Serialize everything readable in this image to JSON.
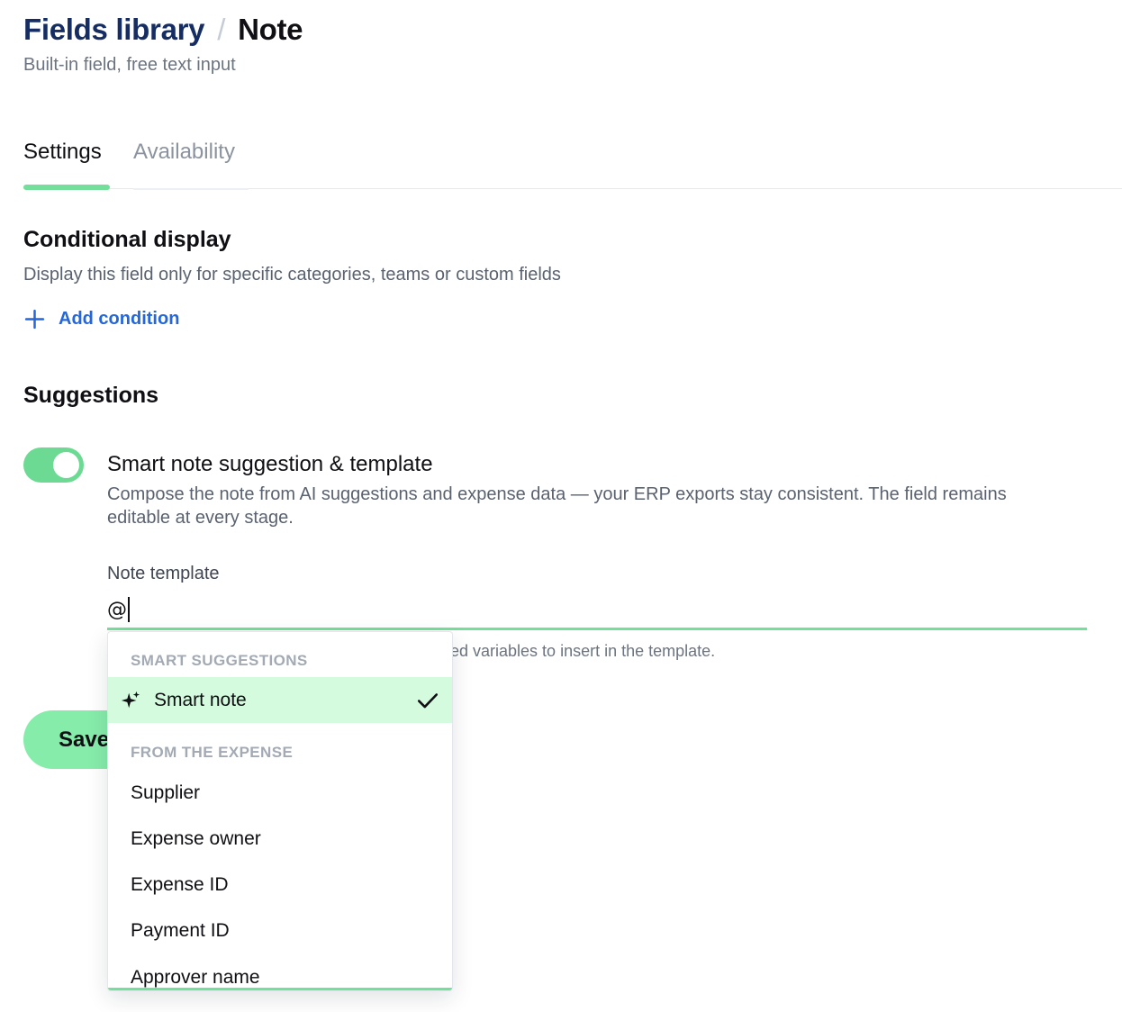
{
  "breadcrumb": {
    "parent": "Fields library",
    "separator": "/",
    "current": "Note"
  },
  "subtitle": "Built-in field, free text input",
  "tabs": [
    {
      "label": "Settings",
      "active": true
    },
    {
      "label": "Availability",
      "active": false
    }
  ],
  "conditional_display": {
    "title": "Conditional display",
    "description": "Display this field only for specific categories, teams or custom fields",
    "add_label": "Add condition"
  },
  "suggestions": {
    "title": "Suggestions",
    "toggle_on": true,
    "setting_title": "Smart note suggestion & template",
    "setting_description": "Compose the note from AI suggestions and expense data — your ERP exports stay consistent. The field remains editable at every stage.",
    "template_label": "Note template",
    "template_value": "@",
    "helper_visible": "ed variables to insert in the template."
  },
  "save_label": "Save",
  "dropdown": {
    "groups": [
      {
        "label": "SMART SUGGESTIONS",
        "options": [
          {
            "label": "Smart note",
            "selected": true,
            "icon": "sparkle-icon"
          }
        ]
      },
      {
        "label": "FROM THE EXPENSE",
        "options": [
          {
            "label": "Supplier"
          },
          {
            "label": "Expense owner"
          },
          {
            "label": "Expense ID"
          },
          {
            "label": "Payment ID"
          },
          {
            "label": "Approver name"
          }
        ]
      }
    ]
  },
  "colors": {
    "accent": "#74df9a",
    "link": "#2567d8",
    "title_navy": "#152d62",
    "selected_bg": "#d4fbdd"
  }
}
